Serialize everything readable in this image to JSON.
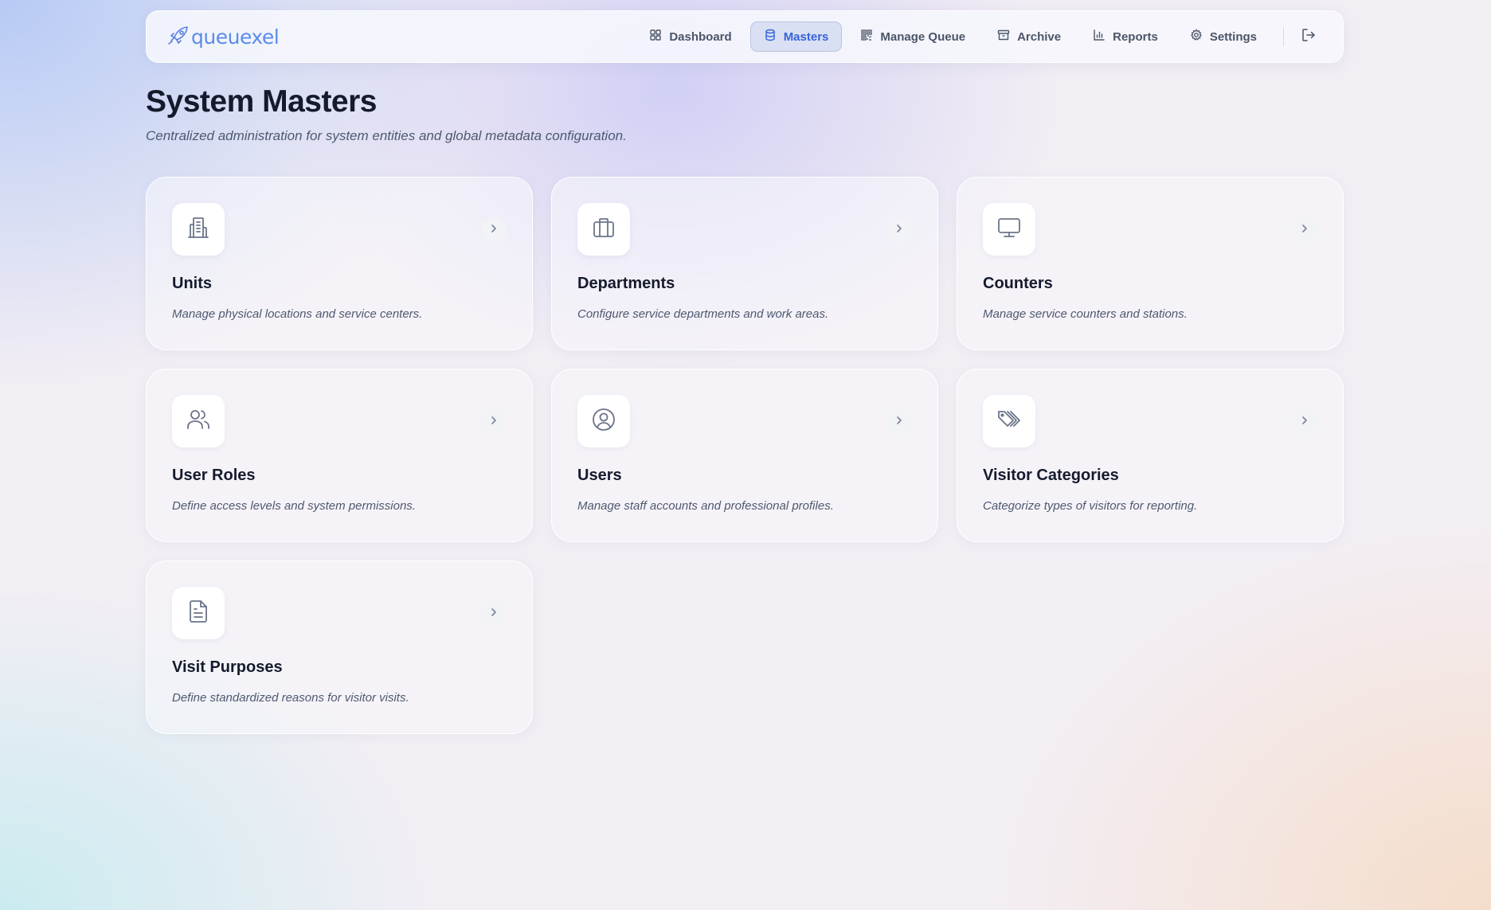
{
  "brand": {
    "logo_text": "queuexel",
    "logo_icon": "rocket-icon"
  },
  "nav": {
    "items": [
      {
        "label": "Dashboard",
        "icon": "grid-icon",
        "active": false
      },
      {
        "label": "Masters",
        "icon": "database-icon",
        "active": true
      },
      {
        "label": "Manage Queue",
        "icon": "qr-icon",
        "active": false
      },
      {
        "label": "Archive",
        "icon": "archive-icon",
        "active": false
      },
      {
        "label": "Reports",
        "icon": "bar-chart-icon",
        "active": false
      },
      {
        "label": "Settings",
        "icon": "gear-icon",
        "active": false
      }
    ],
    "logout_icon": "logout-icon"
  },
  "page": {
    "title": "System Masters",
    "subtitle": "Centralized administration for system entities and global metadata configuration."
  },
  "cards": [
    {
      "title": "Units",
      "description": "Manage physical locations and service centers.",
      "icon": "building-icon"
    },
    {
      "title": "Departments",
      "description": "Configure service departments and work areas.",
      "icon": "briefcase-icon"
    },
    {
      "title": "Counters",
      "description": "Manage service counters and stations.",
      "icon": "monitor-icon"
    },
    {
      "title": "User Roles",
      "description": "Define access levels and system permissions.",
      "icon": "users-icon"
    },
    {
      "title": "Users",
      "description": "Manage staff accounts and professional profiles.",
      "icon": "user-circle-icon"
    },
    {
      "title": "Visitor Categories",
      "description": "Categorize types of visitors for reporting.",
      "icon": "tags-icon"
    },
    {
      "title": "Visit Purposes",
      "description": "Define standardized reasons for visitor visits.",
      "icon": "document-icon"
    }
  ],
  "colors": {
    "accent": "#3563d9",
    "title_text": "#151b2d",
    "muted_text": "#4e5970",
    "icon_stroke": "#6b7489"
  }
}
